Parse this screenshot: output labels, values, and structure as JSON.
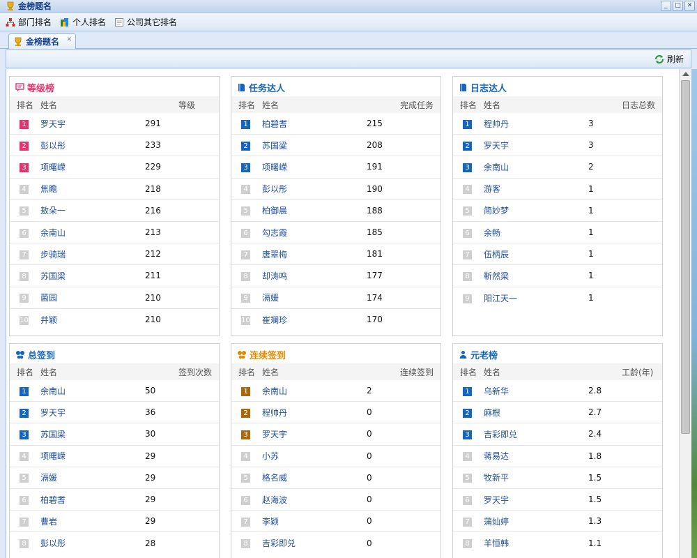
{
  "window": {
    "title": "金榜题名",
    "buttons": [
      "_",
      "□",
      "✕"
    ]
  },
  "menu": {
    "items": [
      {
        "label": "部门排名",
        "icon": "org-chart-icon"
      },
      {
        "label": "个人排名",
        "icon": "people-icon"
      },
      {
        "label": "公司其它排名",
        "icon": "document-icon"
      }
    ]
  },
  "tab": {
    "label": "金榜题名",
    "close": "✕"
  },
  "toolbar": {
    "refresh_label": "刷新"
  },
  "colors": {
    "level": "#e6336b",
    "blue": "#1565c0",
    "signin": "#1565c0",
    "streak": "#e38a00",
    "streak_badge": "#a8680e",
    "elder": "#1565c0"
  },
  "panels": [
    {
      "title": "等级榜",
      "icon": "message-icon",
      "title_color": "#e6336b",
      "badge_color": "#e6336b",
      "headers": [
        "排名",
        "姓名",
        "等级"
      ],
      "rows": [
        {
          "rank": "1",
          "name": "罗天宇",
          "value": "291"
        },
        {
          "rank": "2",
          "name": "彭以彤",
          "value": "233"
        },
        {
          "rank": "3",
          "name": "项曙嵘",
          "value": "229"
        },
        {
          "rank": "4",
          "name": "焦瞻",
          "value": "218"
        },
        {
          "rank": "5",
          "name": "敖朵一",
          "value": "216"
        },
        {
          "rank": "6",
          "name": "余南山",
          "value": "213"
        },
        {
          "rank": "7",
          "name": "步骑瑞",
          "value": "212"
        },
        {
          "rank": "8",
          "name": "苏国梁",
          "value": "211"
        },
        {
          "rank": "9",
          "name": "菌园",
          "value": "210"
        },
        {
          "rank": "10",
          "name": "井颖",
          "value": "210"
        }
      ]
    },
    {
      "title": "任务达人",
      "icon": "book-icon",
      "title_color": "#1565c0",
      "badge_color": "#1565c0",
      "headers": [
        "排名",
        "姓名",
        "完成任务"
      ],
      "rows": [
        {
          "rank": "1",
          "name": "柏碧耆",
          "value": "215"
        },
        {
          "rank": "2",
          "name": "苏国粱",
          "value": "208"
        },
        {
          "rank": "3",
          "name": "项曙嵘",
          "value": "191"
        },
        {
          "rank": "4",
          "name": "彭以彤",
          "value": "190"
        },
        {
          "rank": "5",
          "name": "柏御晨",
          "value": "188"
        },
        {
          "rank": "6",
          "name": "勾志霞",
          "value": "185"
        },
        {
          "rank": "7",
          "name": "唐翠梅",
          "value": "181"
        },
        {
          "rank": "8",
          "name": "却涛鸣",
          "value": "177"
        },
        {
          "rank": "9",
          "name": "滆媛",
          "value": "174"
        },
        {
          "rank": "10",
          "name": "崔斓珍",
          "value": "170"
        }
      ]
    },
    {
      "title": "日志达人",
      "icon": "book-icon",
      "title_color": "#1565c0",
      "badge_color": "#1565c0",
      "headers": [
        "排名",
        "姓名",
        "日志总数"
      ],
      "rows": [
        {
          "rank": "1",
          "name": "程帅丹",
          "value": "3"
        },
        {
          "rank": "2",
          "name": "罗天宇",
          "value": "3"
        },
        {
          "rank": "3",
          "name": "余南山",
          "value": "2"
        },
        {
          "rank": "4",
          "name": "游客",
          "value": "1"
        },
        {
          "rank": "5",
          "name": "简妙梦",
          "value": "1"
        },
        {
          "rank": "6",
          "name": "余畅",
          "value": "1"
        },
        {
          "rank": "7",
          "name": "伍柄辰",
          "value": "1"
        },
        {
          "rank": "8",
          "name": "靳然梁",
          "value": "1"
        },
        {
          "rank": "9",
          "name": "阳江天一",
          "value": "1"
        }
      ]
    },
    {
      "title": "总签到",
      "icon": "butterfly-icon",
      "title_color": "#1565c0",
      "badge_color": "#1565c0",
      "headers": [
        "排名",
        "姓名",
        "签到次数"
      ],
      "rows": [
        {
          "rank": "1",
          "name": "余南山",
          "value": "50"
        },
        {
          "rank": "2",
          "name": "罗天宇",
          "value": "36"
        },
        {
          "rank": "3",
          "name": "苏国梁",
          "value": "30"
        },
        {
          "rank": "4",
          "name": "项曙嵘",
          "value": "29"
        },
        {
          "rank": "5",
          "name": "滆媛",
          "value": "29"
        },
        {
          "rank": "6",
          "name": "柏碧耆",
          "value": "29"
        },
        {
          "rank": "7",
          "name": "曹岩",
          "value": "29"
        },
        {
          "rank": "8",
          "name": "彭以彤",
          "value": "28"
        }
      ]
    },
    {
      "title": "连续签到",
      "icon": "butterfly-icon",
      "title_color": "#e38a00",
      "badge_color": "#a8680e",
      "headers": [
        "排名",
        "姓名",
        "连续签到"
      ],
      "rows": [
        {
          "rank": "1",
          "name": "余南山",
          "value": "2"
        },
        {
          "rank": "2",
          "name": "程帅丹",
          "value": "0"
        },
        {
          "rank": "3",
          "name": "罗天宇",
          "value": "0"
        },
        {
          "rank": "4",
          "name": "小苏",
          "value": "0"
        },
        {
          "rank": "5",
          "name": "格名威",
          "value": "0"
        },
        {
          "rank": "6",
          "name": "赵海波",
          "value": "0"
        },
        {
          "rank": "7",
          "name": "李颖",
          "value": "0"
        },
        {
          "rank": "8",
          "name": "吉彩即兑",
          "value": "0"
        }
      ]
    },
    {
      "title": "元老榜",
      "icon": "person-icon",
      "title_color": "#1565c0",
      "badge_color": "#1565c0",
      "headers": [
        "排名",
        "姓名",
        "工龄(年)"
      ],
      "rows": [
        {
          "rank": "1",
          "name": "乌新华",
          "value": "2.8"
        },
        {
          "rank": "2",
          "name": "麻根",
          "value": "2.7"
        },
        {
          "rank": "3",
          "name": "吉彩即兑",
          "value": "2.4"
        },
        {
          "rank": "4",
          "name": "蒋易达",
          "value": "1.8"
        },
        {
          "rank": "5",
          "name": "牧新平",
          "value": "1.5"
        },
        {
          "rank": "6",
          "name": "罗天宇",
          "value": "1.5"
        },
        {
          "rank": "7",
          "name": "蒲灿婷",
          "value": "1.3"
        },
        {
          "rank": "8",
          "name": "羊恒韩",
          "value": "1.1"
        }
      ]
    }
  ]
}
